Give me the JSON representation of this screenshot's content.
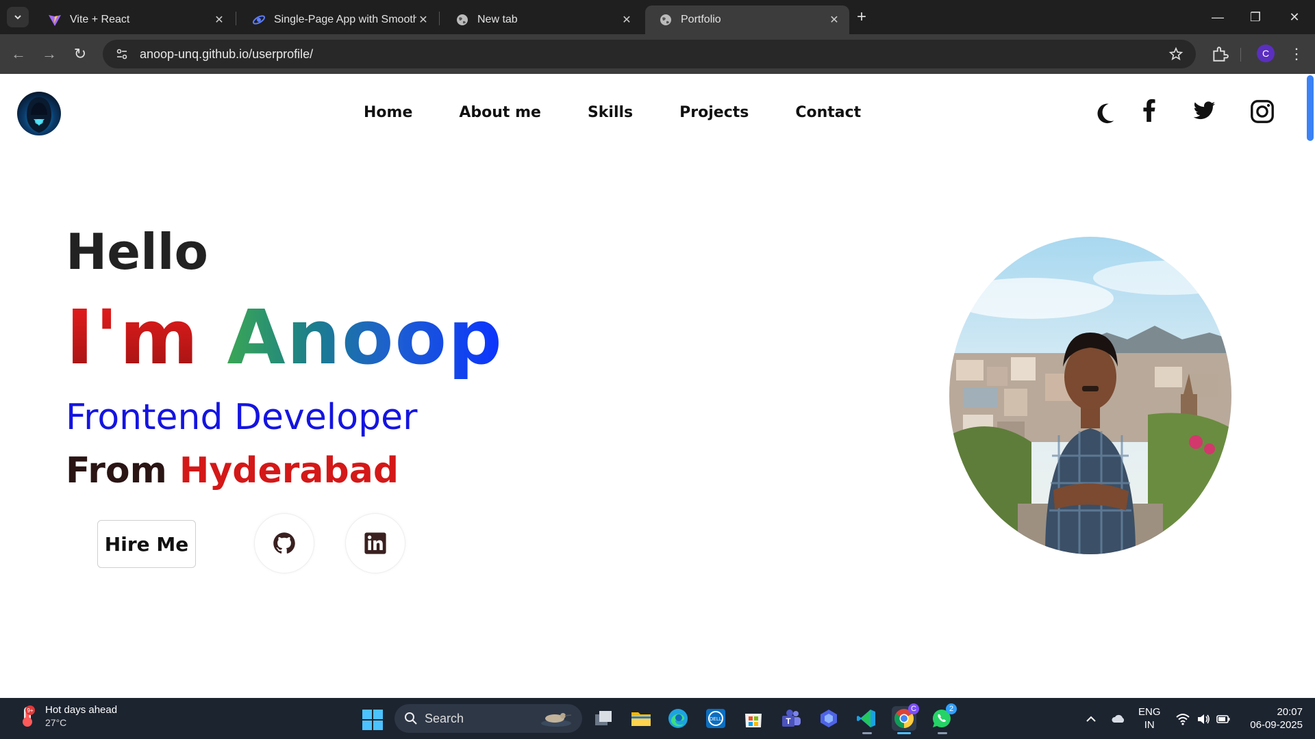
{
  "browser": {
    "tabs": [
      {
        "title": "Vite + React",
        "icon": "vite-icon"
      },
      {
        "title": "Single-Page App with Smooth N",
        "icon": "app-icon"
      },
      {
        "title": "New tab",
        "icon": "globe-icon"
      },
      {
        "title": "Portfolio",
        "icon": "globe-icon",
        "active": true
      }
    ],
    "url": "anoop-unq.github.io/userprofile/",
    "profile_initial": "C"
  },
  "site": {
    "nav": [
      "Home",
      "About me",
      "Skills",
      "Projects",
      "Contact"
    ],
    "hero": {
      "greeting": "Hello",
      "im": "I'm",
      "name": "Anoop",
      "role": "Frontend Developer",
      "from": "From",
      "city": "Hyderabad",
      "hire_label": "Hire Me"
    },
    "social_icons": [
      "moon-icon",
      "facebook-icon",
      "twitter-icon",
      "instagram-icon",
      "github-icon",
      "linkedin-icon"
    ],
    "colors": {
      "role": "#1414e0",
      "city": "#d41818",
      "scroll_accent": "#3b82f6"
    }
  },
  "taskbar": {
    "weather_title": "Hot days ahead",
    "weather_temp": "27°C",
    "weather_badge": "9+",
    "search_label": "Search",
    "whatsapp_badge": "2",
    "lang_top": "ENG",
    "lang_bottom": "IN",
    "time": "20:07",
    "date": "06-09-2025"
  }
}
